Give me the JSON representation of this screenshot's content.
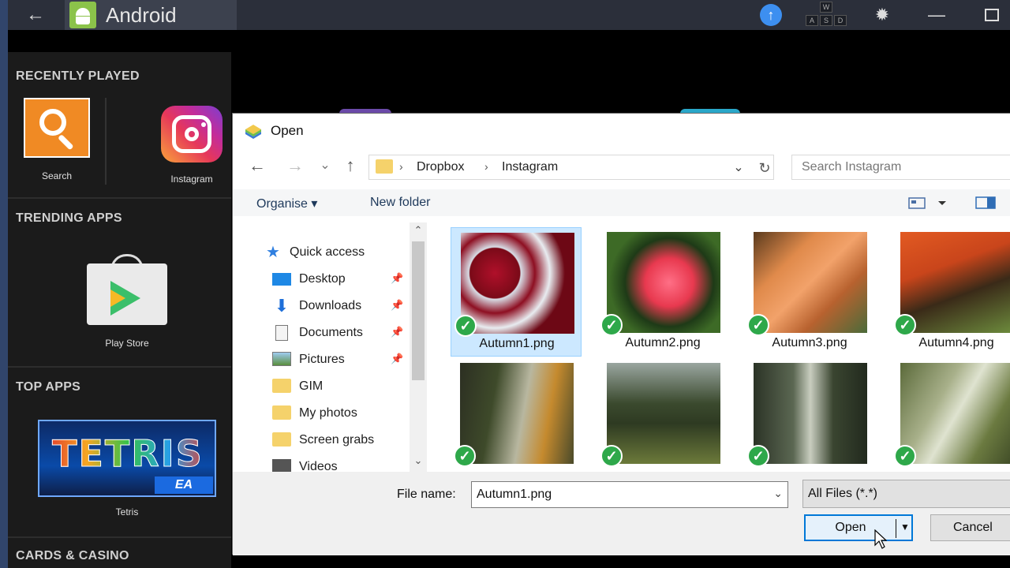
{
  "shell": {
    "title": "Android",
    "back_glyph": "←",
    "upload_glyph": "↑",
    "keys": [
      "W",
      "A",
      "S",
      "D"
    ],
    "gear_glyph": "✹",
    "min_glyph": "—"
  },
  "sidebar": {
    "recently_played_title": "RECENTLY PLAYED",
    "search_label": "Search",
    "instagram_label": "Instagram",
    "trending_title": "TRENDING APPS",
    "play_store_label": "Play Store",
    "top_apps_title": "TOP APPS",
    "tetris_logo": "TETRIS",
    "ea_badge": "EA",
    "tetris_label": "Tetris",
    "cards_title": "CARDS & CASINO"
  },
  "dialog": {
    "title": "Open",
    "back_glyph": "←",
    "forward_glyph": "→",
    "recent_glyph": "⌄",
    "up_glyph": "↑",
    "breadcrumb": [
      "Dropbox",
      "Instagram"
    ],
    "breadcrumb_sep": "›",
    "addr_drop_glyph": "⌄",
    "refresh_glyph": "↻",
    "search_placeholder": "Search Instagram",
    "organise_label": "Organise ▾",
    "new_folder_label": "New folder",
    "nav_items": [
      {
        "label": "Quick access",
        "icon": "star-icon",
        "pinned": false
      },
      {
        "label": "Desktop",
        "icon": "desktop-icon",
        "pinned": true
      },
      {
        "label": "Downloads",
        "icon": "download-icon",
        "pinned": true
      },
      {
        "label": "Documents",
        "icon": "document-icon",
        "pinned": true
      },
      {
        "label": "Pictures",
        "icon": "pictures-icon",
        "pinned": true
      },
      {
        "label": "GIM",
        "icon": "folder-icon",
        "pinned": false
      },
      {
        "label": "My photos",
        "icon": "folder-icon",
        "pinned": false
      },
      {
        "label": "Screen grabs",
        "icon": "folder-icon",
        "pinned": false
      },
      {
        "label": "Videos",
        "icon": "video-icon",
        "pinned": false
      }
    ],
    "pin_glyph": "📌",
    "scroll_up_glyph": "⌃",
    "scroll_down_glyph": "⌄",
    "files": [
      {
        "name": "Autumn1.png",
        "selected": true
      },
      {
        "name": "Autumn2.png",
        "selected": false
      },
      {
        "name": "Autumn3.png",
        "selected": false
      },
      {
        "name": "Autumn4.png",
        "selected": false
      },
      {
        "name": "",
        "selected": false
      },
      {
        "name": "",
        "selected": false
      },
      {
        "name": "",
        "selected": false
      },
      {
        "name": "",
        "selected": false
      }
    ],
    "check_glyph": "✓",
    "file_name_label": "File name:",
    "file_name_value": "Autumn1.png",
    "fn_drop_glyph": "⌄",
    "file_type": "All Files (*.*)",
    "open_label": "Open",
    "open_arrow": "▼",
    "cancel_label": "Cancel"
  },
  "colors": {
    "accent": "#0078d7",
    "selection": "#cce8ff",
    "check": "#2ea84a",
    "search_tile": "#f08a24"
  }
}
